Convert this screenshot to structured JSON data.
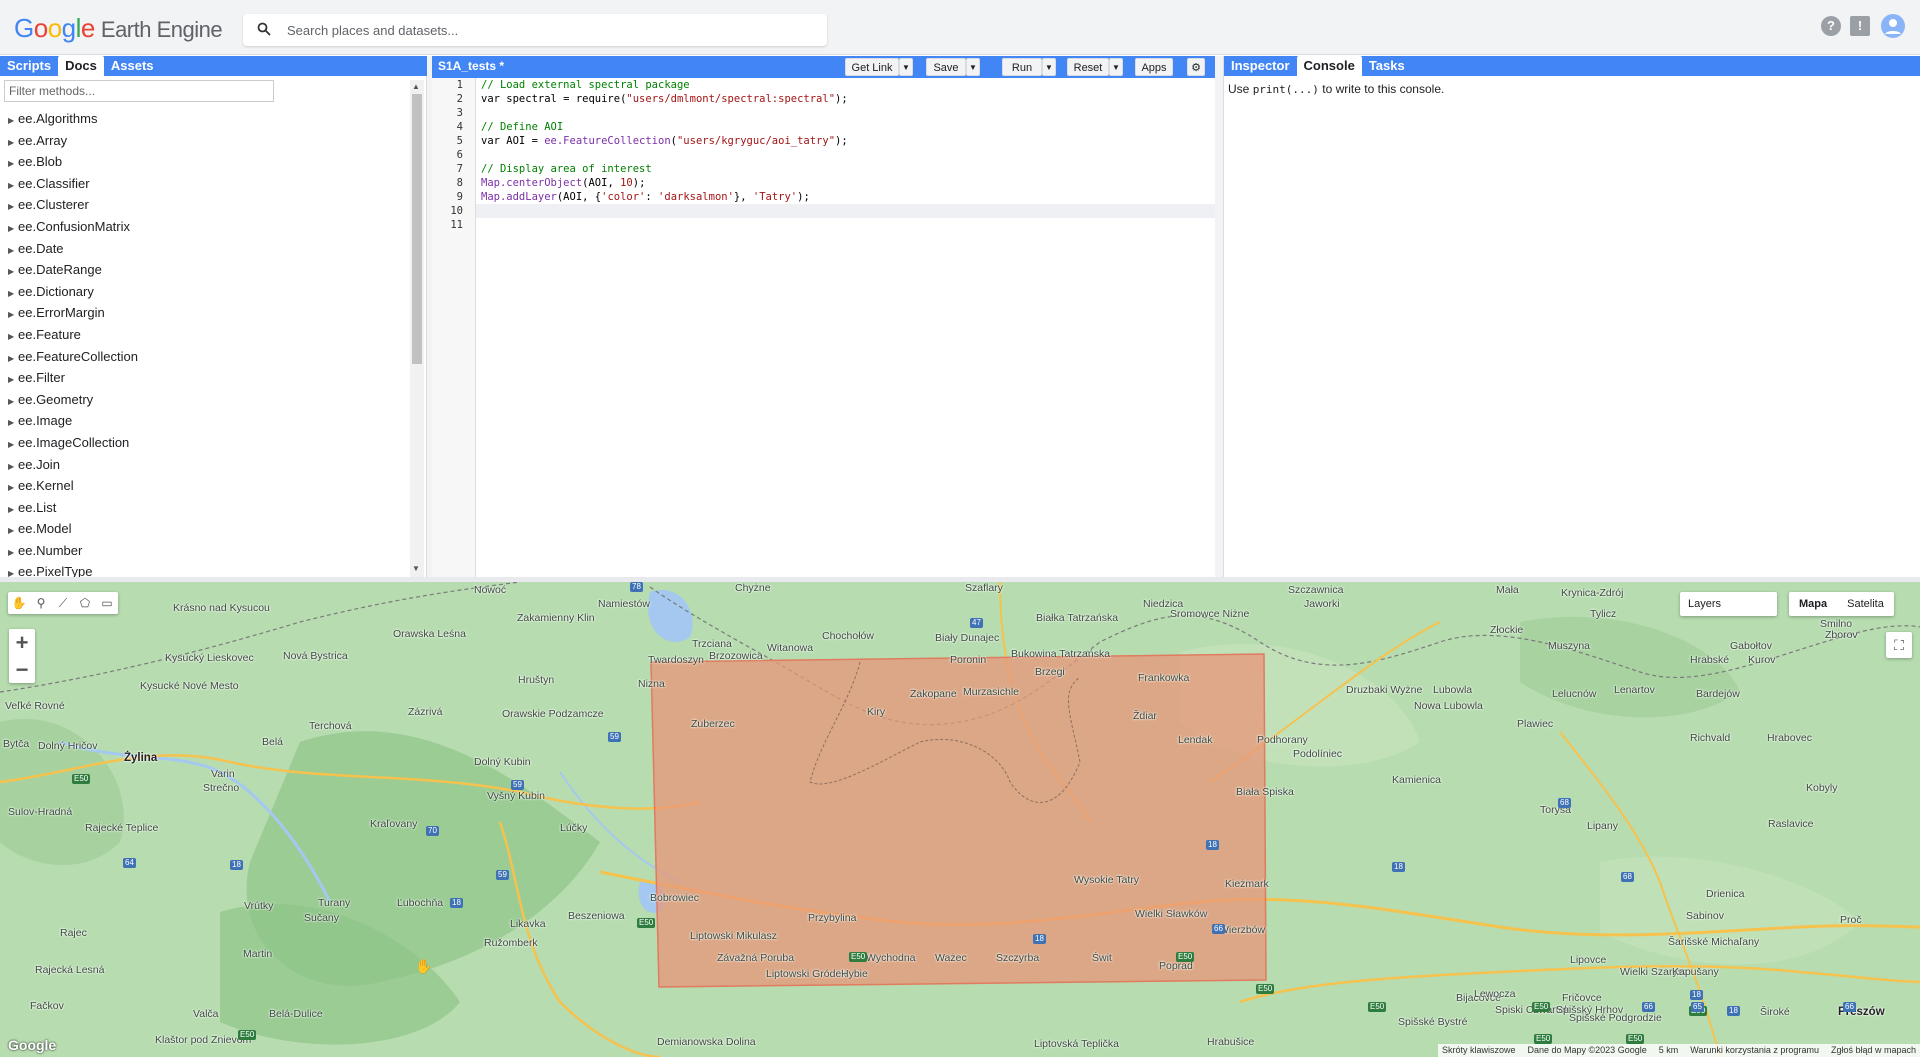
{
  "header": {
    "logo_google": "Google",
    "logo_product": "Earth Engine",
    "search_placeholder": "Search places and datasets...",
    "icons": [
      "help-icon",
      "feedback-icon",
      "account-icon"
    ]
  },
  "left_panel": {
    "tabs": [
      "Scripts",
      "Docs",
      "Assets"
    ],
    "active_tab": "Docs",
    "filter_placeholder": "Filter methods...",
    "methods": [
      "ee.Algorithms",
      "ee.Array",
      "ee.Blob",
      "ee.Classifier",
      "ee.Clusterer",
      "ee.ConfusionMatrix",
      "ee.Date",
      "ee.DateRange",
      "ee.Dictionary",
      "ee.ErrorMargin",
      "ee.Feature",
      "ee.FeatureCollection",
      "ee.Filter",
      "ee.Geometry",
      "ee.Image",
      "ee.ImageCollection",
      "ee.Join",
      "ee.Kernel",
      "ee.List",
      "ee.Model",
      "ee.Number",
      "ee.PixelType"
    ]
  },
  "editor": {
    "file_title": "S1A_tests *",
    "buttons": {
      "get_link": "Get Link",
      "save": "Save",
      "run": "Run",
      "reset": "Reset",
      "apps": "Apps"
    },
    "line_numbers": [
      "1",
      "2",
      "3",
      "4",
      "5",
      "6",
      "7",
      "8",
      "9",
      "10",
      "11"
    ],
    "code": [
      "// Load external spectral package",
      "var spectral = require(\"users/dmlmont/spectral:spectral\");",
      "",
      "// Define AOI",
      "var AOI = ee.FeatureCollection(\"users/kgryguc/aoi_tatry\");",
      "",
      "// Display area of interest",
      "Map.centerObject(AOI, 10);",
      "Map.addLayer(AOI, {'color': 'darksalmon'}, 'Tatry');",
      "",
      ""
    ],
    "current_line": 10
  },
  "right_panel": {
    "tabs": [
      "Inspector",
      "Console",
      "Tasks"
    ],
    "active_tab": "Console",
    "console_pre": "Use",
    "console_code": "print(...)",
    "console_post": "to write to this console."
  },
  "map": {
    "layers_label": "Layers",
    "map_types": [
      "Mapa",
      "Satelita"
    ],
    "selected_map_type": "Mapa",
    "zoom_in": "+",
    "zoom_out": "−",
    "google_mark": "Google",
    "attribution": [
      "Skróty klawiszowe",
      "Dane do Mapy ©2023 Google",
      "5 km",
      "Warunki korzystania z programu",
      "Zgłoś błąd w mapach"
    ],
    "aoi_color": "#e8967a",
    "places": [
      {
        "name": "Nowoć",
        "big": false
      },
      {
        "name": "Namiestów",
        "big": false
      },
      {
        "name": "Chyżne",
        "big": false
      },
      {
        "name": "Szaflary",
        "big": false
      },
      {
        "name": "Niedzica",
        "big": false
      },
      {
        "name": "Szczawnica",
        "big": false
      },
      {
        "name": "Jaworki",
        "big": false
      },
      {
        "name": "Mała",
        "big": false
      },
      {
        "name": "Krynica-Zdrój",
        "big": false
      },
      {
        "name": "Tylicz",
        "big": false
      },
      {
        "name": "Krásno nad Kysucou",
        "big": false
      },
      {
        "name": "Zakamienny Klin",
        "big": false
      },
      {
        "name": "Orawska Leśna",
        "big": false
      },
      {
        "name": "Trzciana",
        "big": false
      },
      {
        "name": "Witanowa",
        "big": false
      },
      {
        "name": "Chochołów",
        "big": false
      },
      {
        "name": "Biały Dunajec",
        "big": false
      },
      {
        "name": "Białka Tatrzańska",
        "big": false
      },
      {
        "name": "Sromowce Niżne",
        "big": false
      },
      {
        "name": "Złockie",
        "big": false
      },
      {
        "name": "Muszyna",
        "big": false
      },
      {
        "name": "Smilno",
        "big": false
      },
      {
        "name": "Zborov",
        "big": false
      },
      {
        "name": "Kysucký Lieskovec",
        "big": false
      },
      {
        "name": "Nová Bystrica",
        "big": false
      },
      {
        "name": "Twardoszyn",
        "big": false
      },
      {
        "name": "Brzozowica",
        "big": false
      },
      {
        "name": "Poronin",
        "big": false
      },
      {
        "name": "Bukowina Tatrzańska",
        "big": false
      },
      {
        "name": "Brzegi",
        "big": false
      },
      {
        "name": "Frankowka",
        "big": false
      },
      {
        "name": "Hruštyn",
        "big": false
      },
      {
        "name": "Nizna",
        "big": false
      },
      {
        "name": "Zakopane",
        "big": false
      },
      {
        "name": "Murzasichle",
        "big": false
      },
      {
        "name": "Gabołtov",
        "big": false
      },
      {
        "name": "Hrabské",
        "big": false
      },
      {
        "name": "Kurov",
        "big": false
      },
      {
        "name": "Kysucké Nové Mesto",
        "big": false
      },
      {
        "name": "Veľké Rovné",
        "big": false
      },
      {
        "name": "Zázrivá",
        "big": false
      },
      {
        "name": "Orawskie Podzamcze",
        "big": false
      },
      {
        "name": "Kiry",
        "big": false
      },
      {
        "name": "Ždiar",
        "big": false
      },
      {
        "name": "Druzbaki Wyżne",
        "big": false
      },
      {
        "name": "Lubowla",
        "big": false
      },
      {
        "name": "Nowa Lubowla",
        "big": false
      },
      {
        "name": "Lelucnów",
        "big": false
      },
      {
        "name": "Lenartov",
        "big": false
      },
      {
        "name": "Bardejów",
        "big": false
      },
      {
        "name": "Terchová",
        "big": false
      },
      {
        "name": "Zuberzec",
        "big": false
      },
      {
        "name": "Plawiec",
        "big": false
      },
      {
        "name": "Richvald",
        "big": false
      },
      {
        "name": "Hrabovec",
        "big": false
      },
      {
        "name": "Dolný Hričov",
        "big": false
      },
      {
        "name": "Bytča",
        "big": false
      },
      {
        "name": "Belá",
        "big": false
      },
      {
        "name": "Żylina",
        "big": true
      },
      {
        "name": "Lendak",
        "big": false
      },
      {
        "name": "Podhorany",
        "big": false
      },
      {
        "name": "Podolíniec",
        "big": false
      },
      {
        "name": "Dolný Kubin",
        "big": false
      },
      {
        "name": "Varin",
        "big": false
      },
      {
        "name": "Strečno",
        "big": false
      },
      {
        "name": "Kamienica",
        "big": false
      },
      {
        "name": "Kobyly",
        "big": false
      },
      {
        "name": "Vyšný Kubin",
        "big": false
      },
      {
        "name": "Biała Spiska",
        "big": false
      },
      {
        "name": "Sulov-Hradná",
        "big": false
      },
      {
        "name": "Torysa",
        "big": false
      },
      {
        "name": "Lipany",
        "big": false
      },
      {
        "name": "Raslavice",
        "big": false
      },
      {
        "name": "Kraľovany",
        "big": false
      },
      {
        "name": "Rajecké Teplice",
        "big": false
      },
      {
        "name": "Lúčky",
        "big": false
      },
      {
        "name": "Wysokie Tatry",
        "big": false
      },
      {
        "name": "Kieżmark",
        "big": false
      },
      {
        "name": "Bobrowiec",
        "big": false
      },
      {
        "name": "Turany",
        "big": false
      },
      {
        "name": "Ľubochňa",
        "big": false
      },
      {
        "name": "Drienica",
        "big": false
      },
      {
        "name": "Vrútky",
        "big": false
      },
      {
        "name": "Sučany",
        "big": false
      },
      {
        "name": "Beszeniowa",
        "big": false
      },
      {
        "name": "Przybylina",
        "big": false
      },
      {
        "name": "Wielki Sławków",
        "big": false
      },
      {
        "name": "Sabinov",
        "big": false
      },
      {
        "name": "Proč",
        "big": false
      },
      {
        "name": "Rajec",
        "big": false
      },
      {
        "name": "Likavka",
        "big": false
      },
      {
        "name": "Liptowski Mikulasz",
        "big": false
      },
      {
        "name": "Wierzbów",
        "big": false
      },
      {
        "name": "Šarišské Michaľany",
        "big": false
      },
      {
        "name": "Ružomberk",
        "big": false
      },
      {
        "name": "Martin",
        "big": false
      },
      {
        "name": "Závažná Poruba",
        "big": false
      },
      {
        "name": "Wychodna",
        "big": false
      },
      {
        "name": "Ważec",
        "big": false
      },
      {
        "name": "Szczyrba",
        "big": false
      },
      {
        "name": "Świt",
        "big": false
      },
      {
        "name": "Poprad",
        "big": false
      },
      {
        "name": "Lipovce",
        "big": false
      },
      {
        "name": "Wielki Szarysz",
        "big": false
      },
      {
        "name": "Kapušany",
        "big": false
      },
      {
        "name": "Rajecká Lesná",
        "big": false
      },
      {
        "name": "Liptowski Gródek",
        "big": false
      },
      {
        "name": "Hybie",
        "big": false
      },
      {
        "name": "Bijacovce",
        "big": false
      },
      {
        "name": "Lewocza",
        "big": false
      },
      {
        "name": "Fričovce",
        "big": false
      },
      {
        "name": "Fačkov",
        "big": false
      },
      {
        "name": "Spiski Czwartek",
        "big": false
      },
      {
        "name": "Spišský Hrhov",
        "big": false
      },
      {
        "name": "Spišské Podgrodzie",
        "big": false
      },
      {
        "name": "Široké",
        "big": false
      },
      {
        "name": "Preszów",
        "big": true
      },
      {
        "name": "Valča",
        "big": false
      },
      {
        "name": "Belá-Dulice",
        "big": false
      },
      {
        "name": "Spišské Bystré",
        "big": false
      },
      {
        "name": "Klaštor pod Znievom",
        "big": false
      },
      {
        "name": "Demianowska Dolina",
        "big": false
      },
      {
        "name": "Liptovská Teplička",
        "big": false
      },
      {
        "name": "Hrabušice",
        "big": false
      }
    ],
    "shields": [
      "78",
      "47",
      "59",
      "E50",
      "59",
      "70",
      "18",
      "59",
      "18",
      "64",
      "18",
      "18",
      "E50",
      "E50",
      "18",
      "66",
      "68",
      "68",
      "E50",
      "E50",
      "E50",
      "66",
      "E50",
      "65",
      "18",
      "66",
      "E50",
      "E50",
      "E50",
      "E50",
      "18"
    ]
  }
}
